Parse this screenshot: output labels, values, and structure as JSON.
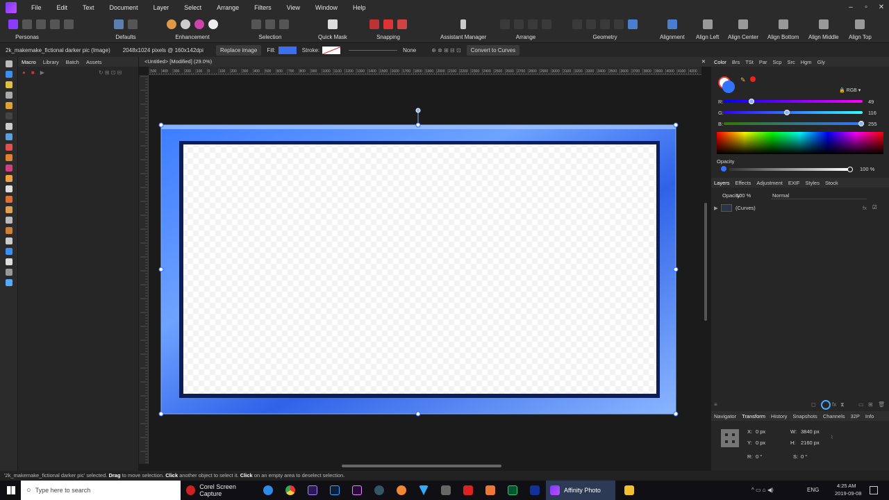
{
  "menu": [
    "File",
    "Edit",
    "Text",
    "Document",
    "Layer",
    "Select",
    "Arrange",
    "Filters",
    "View",
    "Window",
    "Help"
  ],
  "toolbar_groups": [
    {
      "label": "Personas"
    },
    {
      "label": "Defaults"
    },
    {
      "label": "Enhancement"
    },
    {
      "label": "Selection"
    },
    {
      "label": "Quick Mask"
    },
    {
      "label": "Snapping"
    },
    {
      "label": "Assistant Manager"
    },
    {
      "label": "Arrange"
    },
    {
      "label": "Geometry"
    },
    {
      "label": "Alignment"
    },
    {
      "label": "Align Left"
    },
    {
      "label": "Align Center"
    },
    {
      "label": "Align Bottom"
    },
    {
      "label": "Align Middle"
    },
    {
      "label": "Align Top"
    }
  ],
  "context": {
    "layer_name": "2k_makemake_fictional darker pic (Image)",
    "image_size": "2048x1024 pixels @ 160x142dpi",
    "replace_image": "Replace image",
    "fill_label": "Fill:",
    "stroke_label": "Stroke:",
    "stroke_value": "None",
    "convert_curves": "Convert to Curves"
  },
  "left_panel_tabs": [
    "Macro",
    "Library",
    "Batch",
    "Assets"
  ],
  "document_tab": "<Untitled> [Modified] (29.0%)",
  "ruler_top": [
    "500",
    "400",
    "300",
    "200",
    "100",
    "0",
    "100",
    "200",
    "300",
    "400",
    "500",
    "600",
    "700",
    "800",
    "900",
    "1000",
    "1100",
    "1200",
    "1300",
    "1400",
    "1500",
    "1600",
    "1700",
    "1800",
    "1900",
    "2000",
    "2100",
    "2200",
    "2300",
    "2400",
    "2500",
    "2600",
    "2700",
    "2800",
    "2900",
    "3000",
    "3100",
    "3200",
    "3300",
    "3400",
    "3500",
    "3600",
    "3700",
    "3800",
    "3900",
    "4000",
    "4100",
    "4200"
  ],
  "color_panel": {
    "tabs": [
      "Color",
      "Brs",
      "TSt",
      "Par",
      "Scp",
      "Src",
      "Hgm",
      "Gly"
    ],
    "mode": "RGB",
    "r": "49",
    "g": "116",
    "b": "255",
    "r_label": "R:",
    "g_label": "G:",
    "b_label": "B:",
    "opacity_label": "Opacity",
    "opacity_value": "100 %"
  },
  "layers_panel": {
    "tabs": [
      "Layers",
      "Effects",
      "Adjustment",
      "EXIF",
      "Styles",
      "Stock"
    ],
    "opacity_label": "Opacity:",
    "opacity_value": "100 %",
    "blend_mode": "Normal",
    "layer_name": "(Curves)"
  },
  "transform_panel": {
    "tabs": [
      "Navigator",
      "Transform",
      "History",
      "Snapshots",
      "Channels",
      "32P",
      "Info"
    ],
    "x_label": "X:",
    "x": "0 px",
    "y_label": "Y:",
    "y": "0 px",
    "w_label": "W:",
    "w": "3840 px",
    "h_label": "H:",
    "h": "2160 px",
    "r_label": "R:",
    "r": "0 °",
    "s_label": "S:",
    "s": "0 °"
  },
  "status": {
    "selected": "'2k_makemake_fictional darker pic' selected.",
    "drag": "Drag",
    "drag_text": "to move selection.",
    "click": "Click",
    "click_text": "another object to select it.",
    "click2": "Click",
    "click2_text": "on an empty area to deselect selection."
  },
  "taskbar": {
    "search_placeholder": "Type here to search",
    "corel": "Corel Screen Capture",
    "affinity": "Affinity Photo",
    "lang": "ENG",
    "time": "4:25 AM",
    "date": "2019-09-08"
  },
  "colors": {
    "accent": "#3b6ff0",
    "frame_blue": "#2f6bff"
  }
}
